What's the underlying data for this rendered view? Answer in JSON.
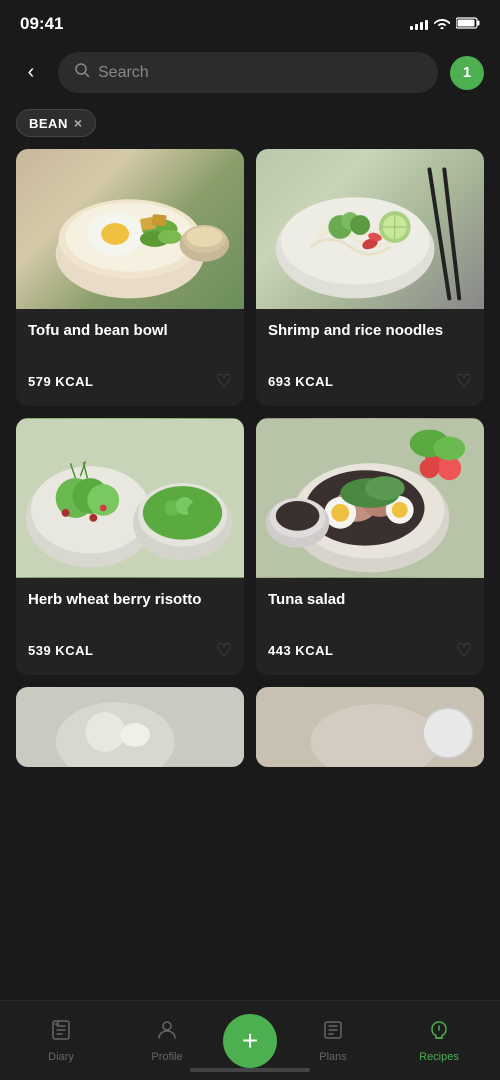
{
  "statusBar": {
    "time": "09:41"
  },
  "header": {
    "backLabel": "‹",
    "searchPlaceholder": "Search",
    "filterCount": "1"
  },
  "filters": [
    {
      "label": "BEAN",
      "removable": true
    }
  ],
  "recipes": [
    {
      "id": "tofu-bean-bowl",
      "name": "Tofu and bean bowl",
      "kcal": "579 KCAL",
      "imageType": "tofu"
    },
    {
      "id": "shrimp-rice-noodles",
      "name": "Shrimp and rice noodles",
      "kcal": "693 KCAL",
      "imageType": "shrimp"
    },
    {
      "id": "herb-wheat-berry-risotto",
      "name": "Herb wheat berry risotto",
      "kcal": "539 KCAL",
      "imageType": "herb"
    },
    {
      "id": "tuna-salad",
      "name": "Tuna salad",
      "kcal": "443 KCAL",
      "imageType": "tuna"
    }
  ],
  "nav": {
    "items": [
      {
        "id": "diary",
        "label": "Diary",
        "icon": "📋",
        "active": false
      },
      {
        "id": "profile",
        "label": "Profile",
        "icon": "👤",
        "active": false
      },
      {
        "id": "plans",
        "label": "Plans",
        "icon": "📄",
        "active": false
      },
      {
        "id": "recipes",
        "label": "Recipes",
        "icon": "🍴",
        "active": true
      }
    ],
    "fab": "+"
  }
}
